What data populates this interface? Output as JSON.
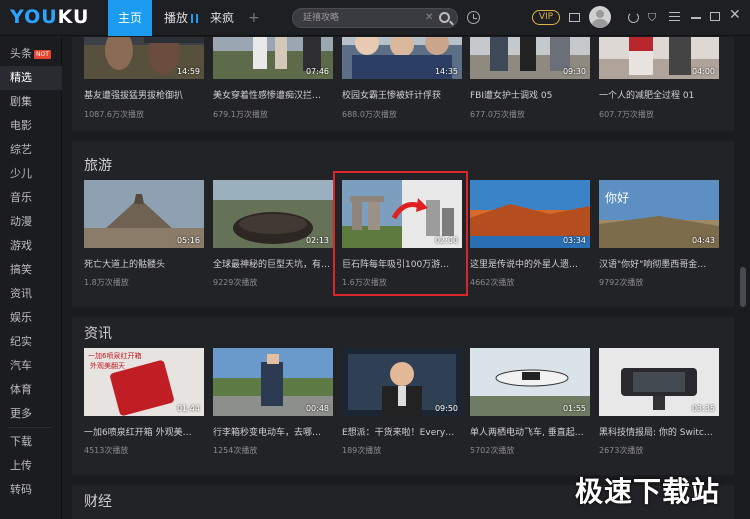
{
  "header": {
    "logo_part1": "YOU",
    "logo_part2": "KU",
    "tabs": [
      "主页",
      "播放",
      "来疯",
      "+"
    ],
    "search_placeholder": "延禧攻略",
    "vip_label": "VIP"
  },
  "sidebar": {
    "items": [
      "头条",
      "精选",
      "剧集",
      "电影",
      "综艺",
      "少儿",
      "音乐",
      "动漫",
      "游戏",
      "搞笑",
      "资讯",
      "娱乐",
      "纪实",
      "汽车",
      "体育",
      "更多"
    ],
    "hot_badge": "NOT",
    "bottom_items": [
      "下载",
      "上传",
      "转码"
    ]
  },
  "sections": [
    {
      "title": "",
      "cards": [
        {
          "title": "基友遭强拔猛男拔枪御扒",
          "plays": "1087.6万次播放",
          "duration": "14:59"
        },
        {
          "title": "美女穿着性感惨遭痴汉拦…",
          "plays": "679.1万次播放",
          "duration": "07:46"
        },
        {
          "title": "校园女霸王惨被奸计俘获",
          "plays": "688.0万次播放",
          "duration": "14:35"
        },
        {
          "title": "FBI遭女护士调戏 05",
          "plays": "677.0万次播放",
          "duration": "09:30"
        },
        {
          "title": "一个人的减肥全过程 01",
          "plays": "607.7万次播放",
          "duration": "04:00"
        }
      ]
    },
    {
      "title": "旅游",
      "cards": [
        {
          "title": "死亡大道上的骷髅头",
          "plays": "1.8万次播放",
          "duration": "05:16"
        },
        {
          "title": "全球最神秘的巨型天坑，有…",
          "plays": "9229次播放",
          "duration": "02:13"
        },
        {
          "title": "巨石阵每年吸引100万游…",
          "plays": "1.6万次播放",
          "duration": "02:00"
        },
        {
          "title": "这里是传说中的外星人遗…",
          "plays": "4662次播放",
          "duration": "03:34"
        },
        {
          "title": "汉语\"你好\"响彻墨西哥金…",
          "plays": "9792次播放",
          "duration": "04:43"
        }
      ]
    },
    {
      "title": "资讯",
      "cards": [
        {
          "title": "一加6喷泉红开箱 外观美…",
          "plays": "4513次播放",
          "duration": "01:44"
        },
        {
          "title": "行李箱秒变电动车，去哪…",
          "plays": "1254次播放",
          "duration": "00:48"
        },
        {
          "title": "E想派：干货来啦！Every…",
          "plays": "189次播放",
          "duration": "09:50"
        },
        {
          "title": "单人两栖电动飞车, 垂直起…",
          "plays": "5702次播放",
          "duration": "01:55"
        },
        {
          "title": "黑科技情报局: 你的 Switc…",
          "plays": "2673次播放",
          "duration": "03:35"
        }
      ]
    },
    {
      "title": "财经",
      "cards": []
    }
  ],
  "thumbnail_texts": {
    "oneplus_banner1": "一加6喷泉红开箱",
    "oneplus_banner2": "外观美翻天",
    "sign_text": "你好"
  },
  "watermark": "极速下载站",
  "colors": {
    "accent": "#1b9cf0",
    "highlight": "#d8262b",
    "hot_badge": "#e6442e"
  }
}
